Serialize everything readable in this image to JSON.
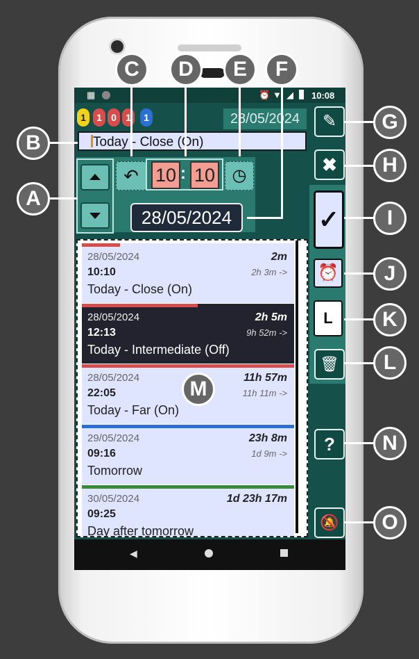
{
  "status": {
    "time": "10:08"
  },
  "badges": [
    "1",
    "1",
    "0",
    "1",
    "1"
  ],
  "header_date": "28/05/2024",
  "title_input": "Today - Close (On)",
  "time": {
    "hours": "10",
    "sep": ":",
    "minutes": "10"
  },
  "selected_date": "28/05/2024",
  "alarms": [
    {
      "date": "28/05/2024",
      "time": "10:10",
      "name": "Today - Close (On)",
      "remaining": "2m",
      "interval": "2h 3m ->",
      "bar": "#d84c4c",
      "bar_fraction": 0.2
    },
    {
      "date": "28/05/2024",
      "time": "12:13",
      "name": "Today - Intermediate  (Off)",
      "remaining": "2h 5m",
      "interval": "9h 52m ->",
      "bar": "#d84c4c",
      "bar_fraction": 0.55
    },
    {
      "date": "28/05/2024",
      "time": "22:05",
      "name": "Today - Far (On)",
      "remaining": "11h 57m",
      "interval": "11h 11m ->",
      "bar": "#d84c4c",
      "bar_fraction": 1
    },
    {
      "date": "29/05/2024",
      "time": "09:16",
      "name": "Tomorrow",
      "remaining": "23h 8m",
      "interval": "1d 9m ->",
      "bar": "#2a6fd6",
      "bar_fraction": 1
    },
    {
      "date": "30/05/2024",
      "time": "09:25",
      "name": "Day after tomorrow",
      "remaining": "1d 23h 17m",
      "interval": "",
      "bar": "#3a8a3a",
      "bar_fraction": 1
    }
  ],
  "side_buttons": {
    "icons": [
      "pencil-icon",
      "close-icon",
      "check-icon",
      "alarm-icon",
      "L",
      "delete-icon",
      "help-icon",
      "bell-off-icon"
    ],
    "l_label": "L",
    "help_label": "?",
    "check_label": "✓"
  },
  "callouts": [
    "A",
    "B",
    "C",
    "D",
    "E",
    "F",
    "G",
    "H",
    "I",
    "J",
    "K",
    "L",
    "M",
    "N",
    "O"
  ],
  "colors": {
    "screen": "#15514a",
    "accent": "#2a7a70",
    "item_bg": "#dfe4ff"
  }
}
